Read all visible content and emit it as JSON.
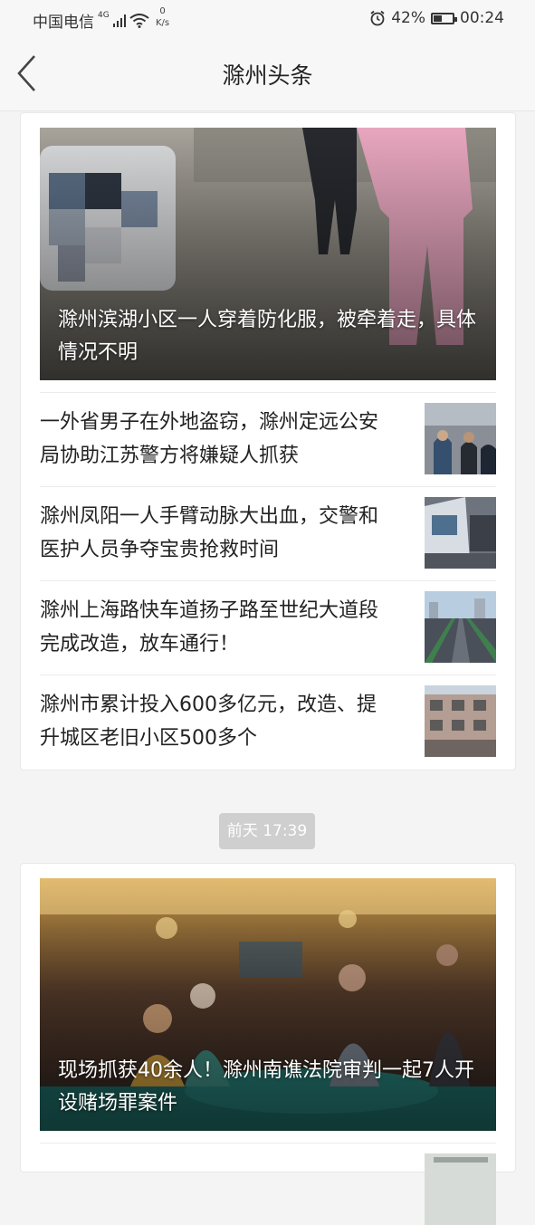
{
  "status_bar": {
    "carrier": "中国电信",
    "network": "4G",
    "speed_value": "0",
    "speed_unit": "K/s",
    "battery": "42%",
    "battery_level": 0.42,
    "time": "00:24"
  },
  "header": {
    "title": "滁州头条"
  },
  "card1": {
    "hero_caption": "滁州滨湖小区一人穿着防化服，被牵着走，具体情况不明",
    "items": [
      {
        "title": "一外省男子在外地盗窃，滁州定远公安局协助江苏警方将嫌疑人抓获"
      },
      {
        "title": "滁州凤阳一人手臂动脉大出血，交警和医护人员争夺宝贵抢救时间"
      },
      {
        "title": "滁州上海路快车道扬子路至世纪大道段完成改造，放车通行！"
      },
      {
        "title": "滁州市累计投入600多亿元，改造、提升城区老旧小区500多个"
      }
    ]
  },
  "timestamp": "前天 17:39",
  "card2": {
    "hero_caption": "现场抓获40余人！滁州南谯法院审判一起7人开设赌场罪案件"
  }
}
